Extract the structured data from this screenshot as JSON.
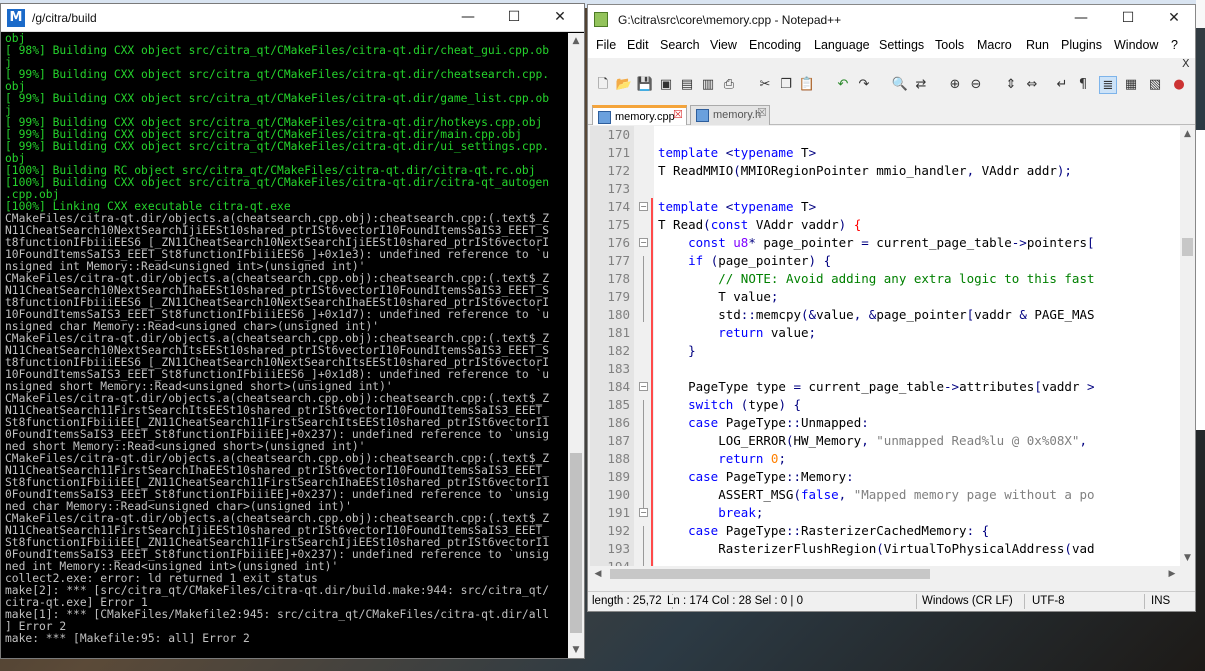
{
  "terminal": {
    "title": "/g/citra/build",
    "logo": "M",
    "lines": [
      {
        "t": "obj",
        "c": "g"
      },
      {
        "t": "[ 98%] Building CXX object src/citra_qt/CMakeFiles/citra-qt.dir/cheat_gui.cpp.ob",
        "c": "g"
      },
      {
        "t": "j",
        "c": "g"
      },
      {
        "t": "[ 99%] Building CXX object src/citra_qt/CMakeFiles/citra-qt.dir/cheatsearch.cpp.",
        "c": "g"
      },
      {
        "t": "obj",
        "c": "g"
      },
      {
        "t": "[ 99%] Building CXX object src/citra_qt/CMakeFiles/citra-qt.dir/game_list.cpp.ob",
        "c": "g"
      },
      {
        "t": "j",
        "c": "g"
      },
      {
        "t": "[ 99%] Building CXX object src/citra_qt/CMakeFiles/citra-qt.dir/hotkeys.cpp.obj",
        "c": "g"
      },
      {
        "t": "[ 99%] Building CXX object src/citra_qt/CMakeFiles/citra-qt.dir/main.cpp.obj",
        "c": "g"
      },
      {
        "t": "[ 99%] Building CXX object src/citra_qt/CMakeFiles/citra-qt.dir/ui_settings.cpp.",
        "c": "g"
      },
      {
        "t": "obj",
        "c": "g"
      },
      {
        "t": "[100%] Building RC object src/citra_qt/CMakeFiles/citra-qt.dir/citra-qt.rc.obj",
        "c": "g"
      },
      {
        "t": "[100%] Building CXX object src/citra_qt/CMakeFiles/citra-qt.dir/citra-qt_autogen",
        "c": "g"
      },
      {
        "t": ".cpp.obj",
        "c": "g"
      },
      {
        "t": "[100%] Linking CXX executable citra-qt.exe",
        "c": "g"
      },
      {
        "t": "CMakeFiles/citra-qt.dir/objects.a(cheatsearch.cpp.obj):cheatsearch.cpp:(.text$_Z",
        "c": "w"
      },
      {
        "t": "N11CheatSearch10NextSearchIjiEESt10shared_ptrISt6vectorI10FoundItemsSaIS3_EEET_S",
        "c": "w"
      },
      {
        "t": "t8functionIFbiiiEES6_[_ZN11CheatSearch10NextSearchIjiEESt10shared_ptrISt6vectorI",
        "c": "w"
      },
      {
        "t": "10FoundItemsSaIS3_EEET_St8functionIFbiiiEES6_]+0x1e3): undefined reference to `u",
        "c": "w"
      },
      {
        "t": "nsigned int Memory::Read<unsigned int>(unsigned int)'",
        "c": "w"
      },
      {
        "t": "CMakeFiles/citra-qt.dir/objects.a(cheatsearch.cpp.obj):cheatsearch.cpp:(.text$_Z",
        "c": "w"
      },
      {
        "t": "N11CheatSearch10NextSearchIhaEESt10shared_ptrISt6vectorI10FoundItemsSaIS3_EEET_S",
        "c": "w"
      },
      {
        "t": "t8functionIFbiiiEES6_[_ZN11CheatSearch10NextSearchIhaEESt10shared_ptrISt6vectorI",
        "c": "w"
      },
      {
        "t": "10FoundItemsSaIS3_EEET_St8functionIFbiiiEES6_]+0x1d7): undefined reference to `u",
        "c": "w"
      },
      {
        "t": "nsigned char Memory::Read<unsigned char>(unsigned int)'",
        "c": "w"
      },
      {
        "t": "CMakeFiles/citra-qt.dir/objects.a(cheatsearch.cpp.obj):cheatsearch.cpp:(.text$_Z",
        "c": "w"
      },
      {
        "t": "N11CheatSearch10NextSearchItsEESt10shared_ptrISt6vectorI10FoundItemsSaIS3_EEET_S",
        "c": "w"
      },
      {
        "t": "t8functionIFbiiiEES6_[_ZN11CheatSearch10NextSearchItsEESt10shared_ptrISt6vectorI",
        "c": "w"
      },
      {
        "t": "10FoundItemsSaIS3_EEET_St8functionIFbiiiEES6_]+0x1d8): undefined reference to `u",
        "c": "w"
      },
      {
        "t": "nsigned short Memory::Read<unsigned short>(unsigned int)'",
        "c": "w"
      },
      {
        "t": "CMakeFiles/citra-qt.dir/objects.a(cheatsearch.cpp.obj):cheatsearch.cpp:(.text$_Z",
        "c": "w"
      },
      {
        "t": "N11CheatSearch11FirstSearchItsEESt10shared_ptrISt6vectorI10FoundItemsSaIS3_EEET_",
        "c": "w"
      },
      {
        "t": "St8functionIFbiiiEE[_ZN11CheatSearch11FirstSearchItsEESt10shared_ptrISt6vectorI1",
        "c": "w"
      },
      {
        "t": "0FoundItemsSaIS3_EEET_St8functionIFbiiiEE]+0x237): undefined reference to `unsig",
        "c": "w"
      },
      {
        "t": "ned short Memory::Read<unsigned short>(unsigned int)'",
        "c": "w"
      },
      {
        "t": "CMakeFiles/citra-qt.dir/objects.a(cheatsearch.cpp.obj):cheatsearch.cpp:(.text$_Z",
        "c": "w"
      },
      {
        "t": "N11CheatSearch11FirstSearchIhaEESt10shared_ptrISt6vectorI10FoundItemsSaIS3_EEET_",
        "c": "w"
      },
      {
        "t": "St8functionIFbiiiEE[_ZN11CheatSearch11FirstSearchIhaEESt10shared_ptrISt6vectorI1",
        "c": "w"
      },
      {
        "t": "0FoundItemsSaIS3_EEET_St8functionIFbiiiEE]+0x237): undefined reference to `unsig",
        "c": "w"
      },
      {
        "t": "ned char Memory::Read<unsigned char>(unsigned int)'",
        "c": "w"
      },
      {
        "t": "CMakeFiles/citra-qt.dir/objects.a(cheatsearch.cpp.obj):cheatsearch.cpp:(.text$_Z",
        "c": "w"
      },
      {
        "t": "N11CheatSearch11FirstSearchIjiEESt10shared_ptrISt6vectorI10FoundItemsSaIS3_EEET_",
        "c": "w"
      },
      {
        "t": "St8functionIFbiiiEE[_ZN11CheatSearch11FirstSearchIjiEESt10shared_ptrISt6vectorI1",
        "c": "w"
      },
      {
        "t": "0FoundItemsSaIS3_EEET_St8functionIFbiiiEE]+0x237): undefined reference to `unsig",
        "c": "w"
      },
      {
        "t": "ned int Memory::Read<unsigned int>(unsigned int)'",
        "c": "w"
      },
      {
        "t": "collect2.exe: error: ld returned 1 exit status",
        "c": "w"
      },
      {
        "t": "make[2]: *** [src/citra_qt/CMakeFiles/citra-qt.dir/build.make:944: src/citra_qt/",
        "c": "w"
      },
      {
        "t": "citra-qt.exe] Error 1",
        "c": "w"
      },
      {
        "t": "make[1]: *** [CMakeFiles/Makefile2:945: src/citra_qt/CMakeFiles/citra-qt.dir/all",
        "c": "w"
      },
      {
        "t": "] Error 2",
        "c": "w"
      },
      {
        "t": "make: *** [Makefile:95: all] Error 2",
        "c": "w"
      }
    ]
  },
  "notepad": {
    "title": "G:\\citra\\src\\core\\memory.cpp - Notepad++",
    "menu": [
      "File",
      "Edit",
      "Search",
      "View",
      "Encoding",
      "Language",
      "Settings",
      "Tools",
      "Macro",
      "Run",
      "Plugins",
      "Window",
      "?"
    ],
    "menu_close": "X",
    "tabs": [
      {
        "label": "memory.cpp",
        "close": "☒"
      },
      {
        "label": "memory.h",
        "close": "☒"
      }
    ],
    "gutter": [
      "170",
      "171",
      "172",
      "173",
      "174",
      "175",
      "176",
      "177",
      "178",
      "179",
      "180",
      "181",
      "182",
      "183",
      "184",
      "185",
      "186",
      "187",
      "188",
      "189",
      "190",
      "191",
      "192",
      "193",
      "194"
    ],
    "status": {
      "length": "length : 25,72",
      "position": "Ln : 174    Col : 28    Sel : 0 | 0",
      "eol": "Windows (CR LF)",
      "encoding": "UTF-8",
      "mode": "INS"
    }
  },
  "colors": {
    "terminal_green": "#25d32c",
    "terminal_text": "#c0c0c0",
    "keyword": "#0000ff",
    "type": "#8000ff",
    "comment": "#008000",
    "string": "#808080",
    "number": "#ff8000"
  }
}
